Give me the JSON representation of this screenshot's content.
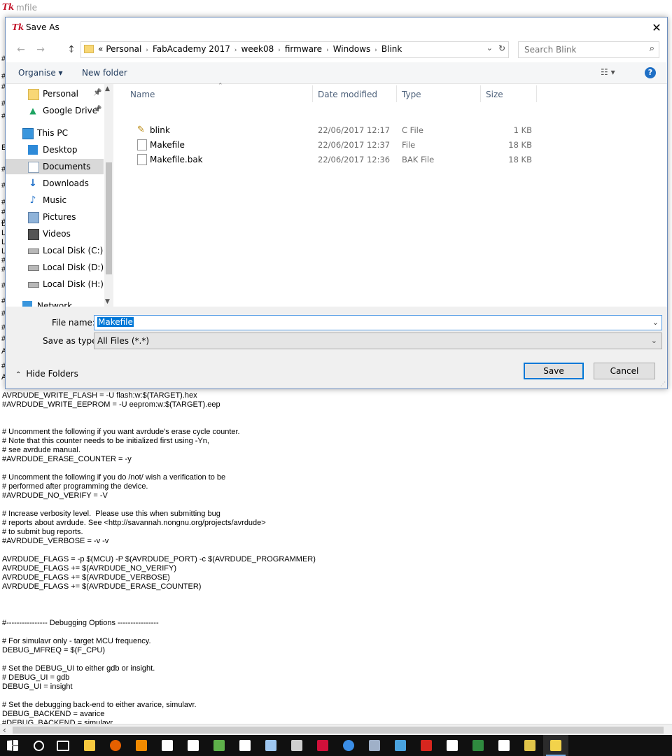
{
  "background_window": {
    "title": "mfile",
    "left_marks": [
      "#",
      "#",
      "#",
      "#",
      "#",
      "E",
      "#",
      "#",
      "#",
      "#",
      "#",
      "L",
      "L",
      "L",
      "L",
      "#",
      "#",
      "#",
      "#",
      "#",
      "#",
      "#",
      "A",
      "#",
      "A"
    ],
    "code": "AVRDUDE_WRITE_FLASH = -U flash:w:$(TARGET).hex\n#AVRDUDE_WRITE_EEPROM = -U eeprom:w:$(TARGET).eep\n\n\n# Uncomment the following if you want avrdude's erase cycle counter.\n# Note that this counter needs to be initialized first using -Yn,\n# see avrdude manual.\n#AVRDUDE_ERASE_COUNTER = -y\n\n# Uncomment the following if you do /not/ wish a verification to be\n# performed after programming the device.\n#AVRDUDE_NO_VERIFY = -V\n\n# Increase verbosity level.  Please use this when submitting bug\n# reports about avrdude. See <http://savannah.nongnu.org/projects/avrdude>\n# to submit bug reports.\n#AVRDUDE_VERBOSE = -v -v\n\nAVRDUDE_FLAGS = -p $(MCU) -P $(AVRDUDE_PORT) -c $(AVRDUDE_PROGRAMMER)\nAVRDUDE_FLAGS += $(AVRDUDE_NO_VERIFY)\nAVRDUDE_FLAGS += $(AVRDUDE_VERBOSE)\nAVRDUDE_FLAGS += $(AVRDUDE_ERASE_COUNTER)\n\n\n\n#---------------- Debugging Options ----------------\n\n# For simulavr only - target MCU frequency.\nDEBUG_MFREQ = $(F_CPU)\n\n# Set the DEBUG_UI to either gdb or insight.\n# DEBUG_UI = gdb\nDEBUG_UI = insight\n\n# Set the debugging back-end to either avarice, simulavr.\nDEBUG_BACKEND = avarice\n#DEBUG_BACKEND = simulavr"
  },
  "dialog": {
    "title": "Save As",
    "close_symbol": "✕",
    "address": {
      "overflow": "«",
      "crumbs": [
        "Personal",
        "FabAcademy 2017",
        "week08",
        "firmware",
        "Windows",
        "Blink"
      ]
    },
    "search_placeholder": "Search Blink",
    "toolbar": {
      "organise": "Organise ▾",
      "new_folder": "New folder",
      "help": "?"
    },
    "nav_items": [
      {
        "label": "Personal",
        "icon": "folder-icon",
        "pinned": true
      },
      {
        "label": "Google Drive",
        "icon": "google-drive-icon",
        "pinned": true
      },
      {
        "label": "This PC",
        "icon": "computer-icon",
        "pinned": false
      },
      {
        "label": "Desktop",
        "icon": "desktop-icon",
        "pinned": false
      },
      {
        "label": "Documents",
        "icon": "documents-icon",
        "pinned": false,
        "selected": true
      },
      {
        "label": "Downloads",
        "icon": "download-icon",
        "pinned": false
      },
      {
        "label": "Music",
        "icon": "music-icon",
        "pinned": false
      },
      {
        "label": "Pictures",
        "icon": "pictures-icon",
        "pinned": false
      },
      {
        "label": "Videos",
        "icon": "videos-icon",
        "pinned": false
      },
      {
        "label": "Local Disk (C:)",
        "icon": "disk-icon",
        "pinned": false
      },
      {
        "label": "Local Disk (D:)",
        "icon": "disk-icon",
        "pinned": false
      },
      {
        "label": "Local Disk (H:)",
        "icon": "disk-icon",
        "pinned": false
      },
      {
        "label": "Network",
        "icon": "network-icon",
        "pinned": false
      }
    ],
    "columns": {
      "name": "Name",
      "date": "Date modified",
      "type": "Type",
      "size": "Size"
    },
    "files": [
      {
        "name": "blink",
        "date": "22/06/2017 12:17",
        "type": "C File",
        "size": "1 KB",
        "icon": "c-file-icon"
      },
      {
        "name": "Makefile",
        "date": "22/06/2017 12:37",
        "type": "File",
        "size": "18 KB",
        "icon": "file-icon"
      },
      {
        "name": "Makefile.bak",
        "date": "22/06/2017 12:36",
        "type": "BAK File",
        "size": "18 KB",
        "icon": "file-icon"
      }
    ],
    "file_name_label": "File name:",
    "file_name_value": "Makefile",
    "save_type_label": "Save as type:",
    "save_type_value": "All Files (*.*)",
    "hide_folders": "Hide Folders",
    "save": "Save",
    "cancel": "Cancel"
  },
  "taskbar": {
    "icons": [
      {
        "name": "start-icon",
        "color": "#ffffff"
      },
      {
        "name": "search-icon",
        "color": "#ffffff"
      },
      {
        "name": "task-view-icon",
        "color": "#ffffff"
      },
      {
        "name": "file-explorer-icon",
        "color": "#f8c93f"
      },
      {
        "name": "firefox-icon",
        "color": "#e66000"
      },
      {
        "name": "vlc-icon",
        "color": "#f18a00"
      },
      {
        "name": "mail-icon",
        "color": "#ffffff"
      },
      {
        "name": "notepad-icon",
        "color": "#ffffff"
      },
      {
        "name": "inkscape-icon",
        "color": "#5eb04a"
      },
      {
        "name": "solitaire-icon",
        "color": "#ffffff"
      },
      {
        "name": "notes-icon",
        "color": "#9ec7f0"
      },
      {
        "name": "arduino-icon",
        "color": "#cfcfcf"
      },
      {
        "name": "app-red-icon",
        "color": "#d1103a"
      },
      {
        "name": "chrome-icon",
        "color": "#3b8ee6"
      },
      {
        "name": "photos-icon",
        "color": "#9fb0c8"
      },
      {
        "name": "monitor-icon",
        "color": "#4aa3df"
      },
      {
        "name": "acrobat-icon",
        "color": "#d7261e"
      },
      {
        "name": "settings-icon",
        "color": "#ffffff"
      },
      {
        "name": "calculator-icon",
        "color": "#2f8a3f"
      },
      {
        "name": "store-icon",
        "color": "#ffffff"
      },
      {
        "name": "editor-icon",
        "color": "#e0c44a"
      },
      {
        "name": "python-icon",
        "color": "#f2d24b"
      }
    ]
  }
}
